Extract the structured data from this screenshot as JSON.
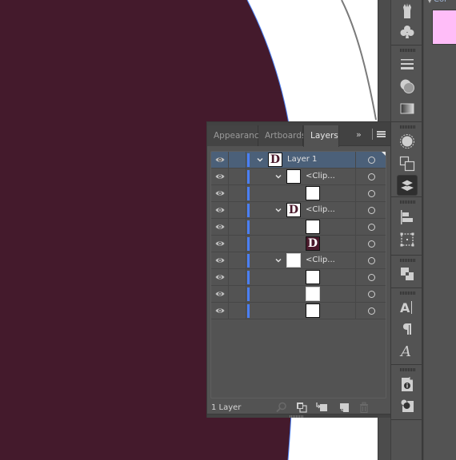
{
  "canvas": {
    "artwork_color": "#441a2c",
    "artboard_color": "#ffffff",
    "selection_color": "#4a7ff5"
  },
  "layers_panel": {
    "tabs": [
      {
        "label": "Appearance",
        "active": false
      },
      {
        "label": "Artboards",
        "active": false
      },
      {
        "label": "Layers",
        "active": true
      }
    ],
    "overflow_label": "»",
    "rows": [
      {
        "label": "Layer 1",
        "level": 0,
        "expanded": true,
        "thumb": "d",
        "selected": true
      },
      {
        "label": "<Clip...",
        "level": 1,
        "expanded": true,
        "thumb": "white"
      },
      {
        "label": "",
        "level": 2,
        "thumb": "white"
      },
      {
        "label": "<Clip...",
        "level": 1,
        "expanded": true,
        "thumb": "d"
      },
      {
        "label": "",
        "level": 2,
        "thumb": "white"
      },
      {
        "label": "",
        "level": 2,
        "thumb": "d-dark"
      },
      {
        "label": "<Clip...",
        "level": 1,
        "expanded": true,
        "thumb": "light"
      },
      {
        "label": "",
        "level": 2,
        "thumb": "white"
      },
      {
        "label": "",
        "level": 2,
        "thumb": "light"
      },
      {
        "label": "",
        "level": 2,
        "thumb": "white"
      }
    ],
    "footer": {
      "count_label": "1 Layer",
      "icons": [
        "search-icon",
        "make-clipping-mask-icon",
        "create-sublayer-icon",
        "new-layer-icon",
        "trash-icon"
      ]
    },
    "thumb_glyph": "D",
    "layer_color": "#4a7ff5"
  },
  "toolstrip": {
    "tools": [
      "symbol-sprayer-icon",
      "symbols-icon",
      "stroke-icon",
      "transparency-icon",
      "gradient-icon",
      "appearance-icon",
      "artboards-icon",
      "layers-icon",
      "align-icon",
      "transform-icon",
      "pathfinder-icon",
      "character-icon",
      "paragraph-icon",
      "opentype-icon",
      "document-info-icon",
      "links-icon"
    ],
    "active_tool": "layers-icon"
  },
  "right_panel": {
    "label": "Col",
    "swatch_color": "#ffbdf8"
  }
}
